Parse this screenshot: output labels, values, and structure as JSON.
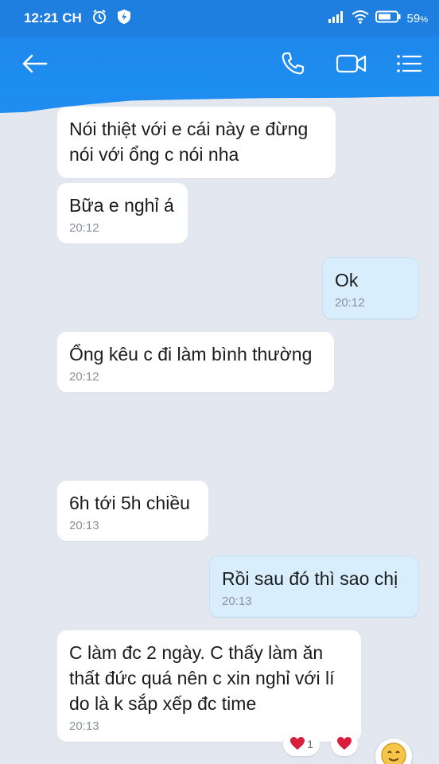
{
  "status_bar": {
    "time": "12:21 CH",
    "battery": "59"
  },
  "header": {
    "back_icon": "back-arrow-icon",
    "call_icon": "phone-icon",
    "video_icon": "video-camera-icon",
    "menu_icon": "menu-list-icon"
  },
  "messages": [
    {
      "direction": "in",
      "lines": [
        "Nói thiệt với e cái này e đừng",
        "nói với ổng c nói nha"
      ],
      "time": ""
    },
    {
      "direction": "in",
      "lines": [
        "Bữa e nghỉ á"
      ],
      "time": "20:12"
    },
    {
      "direction": "out",
      "lines": [
        "Ok"
      ],
      "time": "20:12"
    },
    {
      "direction": "in",
      "lines": [
        "Ổng kêu c đi làm bình thường"
      ],
      "time": "20:12"
    },
    {
      "direction": "in",
      "lines": [
        "6h tới 5h chiều"
      ],
      "time": "20:13"
    },
    {
      "direction": "out",
      "lines": [
        "Rồi sau đó thì sao chị"
      ],
      "time": "20:13"
    },
    {
      "direction": "in",
      "lines": [
        "C làm đc 2 ngày. C thấy làm ăn",
        "thất đức quá nên c xin nghỉ với lí",
        "do là k sắp xếp đc time"
      ],
      "time": "20:13"
    }
  ],
  "reactions": {
    "count": "1",
    "heart_color": "#d81e3c"
  }
}
